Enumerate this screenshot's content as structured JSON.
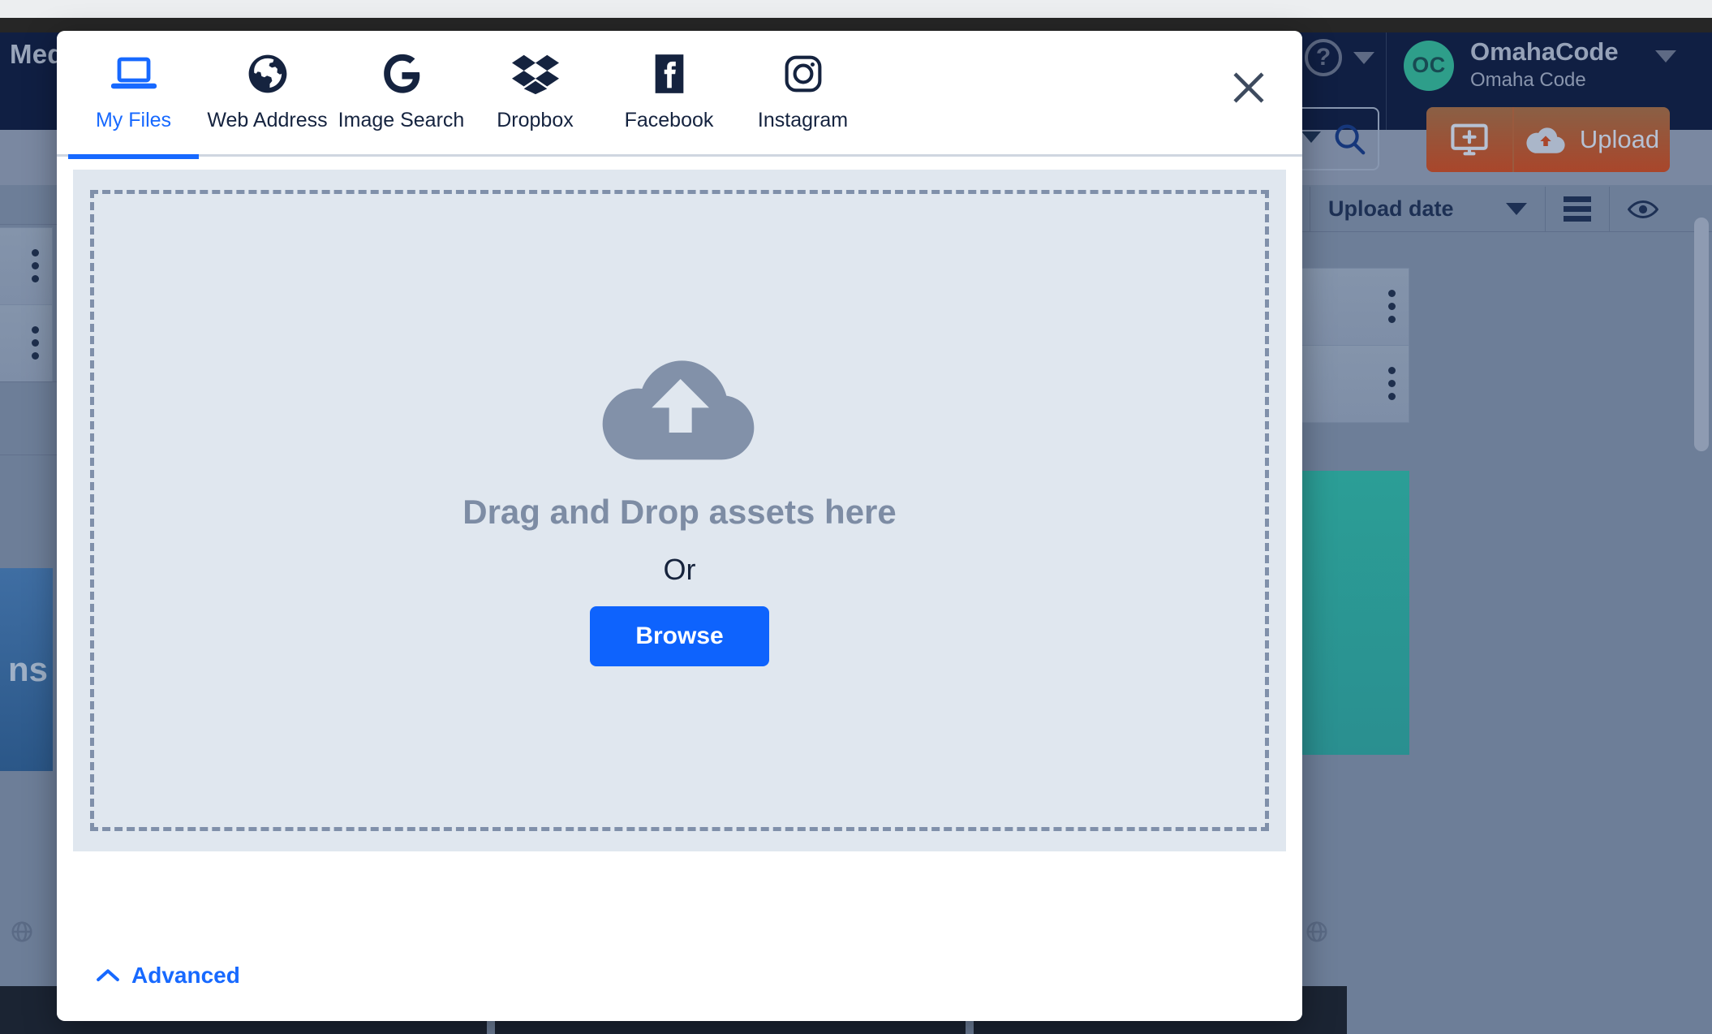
{
  "background": {
    "nav_title": "Medi",
    "help_icon": "question-mark-icon",
    "account": {
      "initials": "OC",
      "name": "OmahaCode",
      "subtitle": "Omaha Code"
    },
    "toolbar": {
      "search_icon": "search-icon",
      "filter_icon": "filter-lines-icon",
      "add_screen_label": "add-screen-icon",
      "upload_label": "Upload"
    },
    "sort": {
      "sort_arrow": "sort-descending-icon",
      "sort_by": "Upload date",
      "list_view_icon": "list-view-icon",
      "preview_icon": "eye-icon"
    },
    "tile_text": "ns"
  },
  "modal": {
    "close_icon": "close-icon",
    "tabs": [
      {
        "label": "My Files",
        "icon": "laptop-icon",
        "active": true
      },
      {
        "label": "Web Address",
        "icon": "globe-icon",
        "active": false
      },
      {
        "label": "Image Search",
        "icon": "google-g-icon",
        "active": false
      },
      {
        "label": "Dropbox",
        "icon": "dropbox-icon",
        "active": false
      },
      {
        "label": "Facebook",
        "icon": "facebook-icon",
        "active": false
      },
      {
        "label": "Instagram",
        "icon": "instagram-icon",
        "active": false
      }
    ],
    "dropzone": {
      "icon": "cloud-upload-icon",
      "title": "Drag and Drop assets here",
      "or": "Or",
      "browse_label": "Browse"
    },
    "footer": {
      "advanced_label": "Advanced",
      "advanced_icon": "chevron-up-icon"
    }
  },
  "colors": {
    "accent_blue": "#1769ff",
    "browse_blue": "#0e63fd",
    "navy": "#101f43",
    "dropzone_bg": "#e0e7ef",
    "dashed_border": "#8090aa",
    "upload_orange": "#a9462b",
    "avatar_teal": "#2e9e8a"
  }
}
